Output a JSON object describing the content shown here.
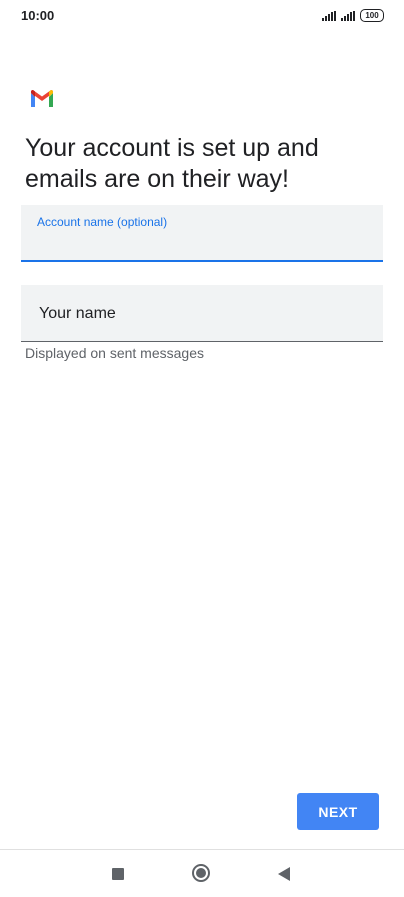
{
  "status_bar": {
    "time": "10:00",
    "battery": "100",
    "icons": [
      "signal-icon",
      "signal-icon",
      "battery-icon"
    ]
  },
  "app": {
    "logo_icon": "gmail-logo-icon",
    "logo_colors": {
      "blue": "#4285f4",
      "red": "#ea4335",
      "yellow": "#fbbc04",
      "green": "#34a853"
    }
  },
  "page": {
    "headline": "Your account is set up and emails are on their way!"
  },
  "form": {
    "account_name": {
      "label": "Account name (optional)",
      "value": ""
    },
    "your_name": {
      "placeholder": "Your name",
      "value": "",
      "helper": "Displayed on sent messages"
    }
  },
  "actions": {
    "next_label": "NEXT"
  },
  "navigation": {
    "icons": [
      "recents-icon",
      "home-icon",
      "back-icon"
    ]
  },
  "colors": {
    "accent": "#1a73e8",
    "button": "#4285f4",
    "field_background": "#f1f3f4",
    "text": "#202124",
    "secondary_text": "#5f6368"
  }
}
